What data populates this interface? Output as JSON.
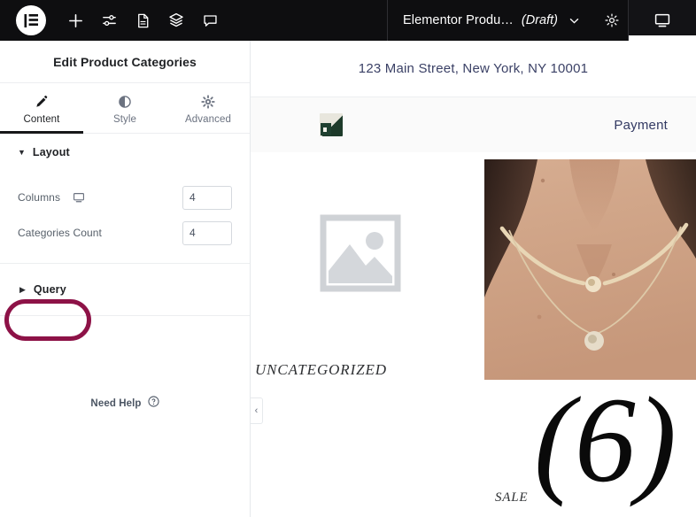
{
  "topbar": {
    "logo_icon": "elementor-logo-icon",
    "icons": [
      {
        "name": "add-element-icon",
        "glyph": "plus"
      },
      {
        "name": "site-settings-sliders-icon",
        "glyph": "sliders"
      },
      {
        "name": "page-settings-document-icon",
        "glyph": "document"
      },
      {
        "name": "navigator-layers-icon",
        "glyph": "layers"
      },
      {
        "name": "notes-comment-icon",
        "glyph": "comment"
      }
    ],
    "document_title": "Elementor Produ…",
    "document_status": "(Draft)",
    "status_chevron": "chevron-down-icon",
    "settings_icon": "gear-icon",
    "responsive_icon": "desktop-monitor-icon"
  },
  "panel": {
    "title": "Edit Product Categories",
    "tabs": [
      {
        "label": "Content",
        "icon": "pencil-icon",
        "active": true
      },
      {
        "label": "Style",
        "icon": "half-circle-icon",
        "active": false
      },
      {
        "label": "Advanced",
        "icon": "gear-icon",
        "active": false
      }
    ],
    "sections": [
      {
        "name": "layout",
        "title": "Layout",
        "expanded": true,
        "toggle_icon": "triangle-down-icon",
        "controls": [
          {
            "label": "Columns",
            "responsive_icon": "desktop-monitor-icon",
            "value": "4",
            "placeholder": "4"
          },
          {
            "label": "Categories Count",
            "responsive_icon": "",
            "value": "4",
            "placeholder": "4"
          }
        ]
      },
      {
        "name": "query",
        "title": "Query",
        "expanded": false,
        "toggle_icon": "triangle-right-icon",
        "controls": []
      }
    ],
    "need_help": {
      "label": "Need Help",
      "icon": "question-circle-icon"
    },
    "collapse_handle": {
      "name": "collapse-panel-handle",
      "glyph": "‹"
    },
    "annotation": {
      "target": "query",
      "shape": "oval",
      "color": "#8d1247"
    }
  },
  "canvas": {
    "site_topbar": {
      "address": "123 Main Street, New York, NY 10001"
    },
    "site_header": {
      "brand_icon": "site-logo-thumbnail",
      "nav_items": [
        {
          "label": "Payment"
        }
      ]
    },
    "product_categories": [
      {
        "name": "uncategorized",
        "label": "UNCATEGORIZED",
        "count": "",
        "image": "woocommerce-placeholder-image"
      },
      {
        "name": "sale",
        "label": "SALE",
        "count": "(6)",
        "image": "necklace-photo"
      }
    ]
  },
  "colors": {
    "topbar_bg": "#0e0e10",
    "accent_dark": "#17181a",
    "annotation": "#8d1247",
    "site_navy": "#333a63",
    "panel_border": "#e6e9ec"
  }
}
